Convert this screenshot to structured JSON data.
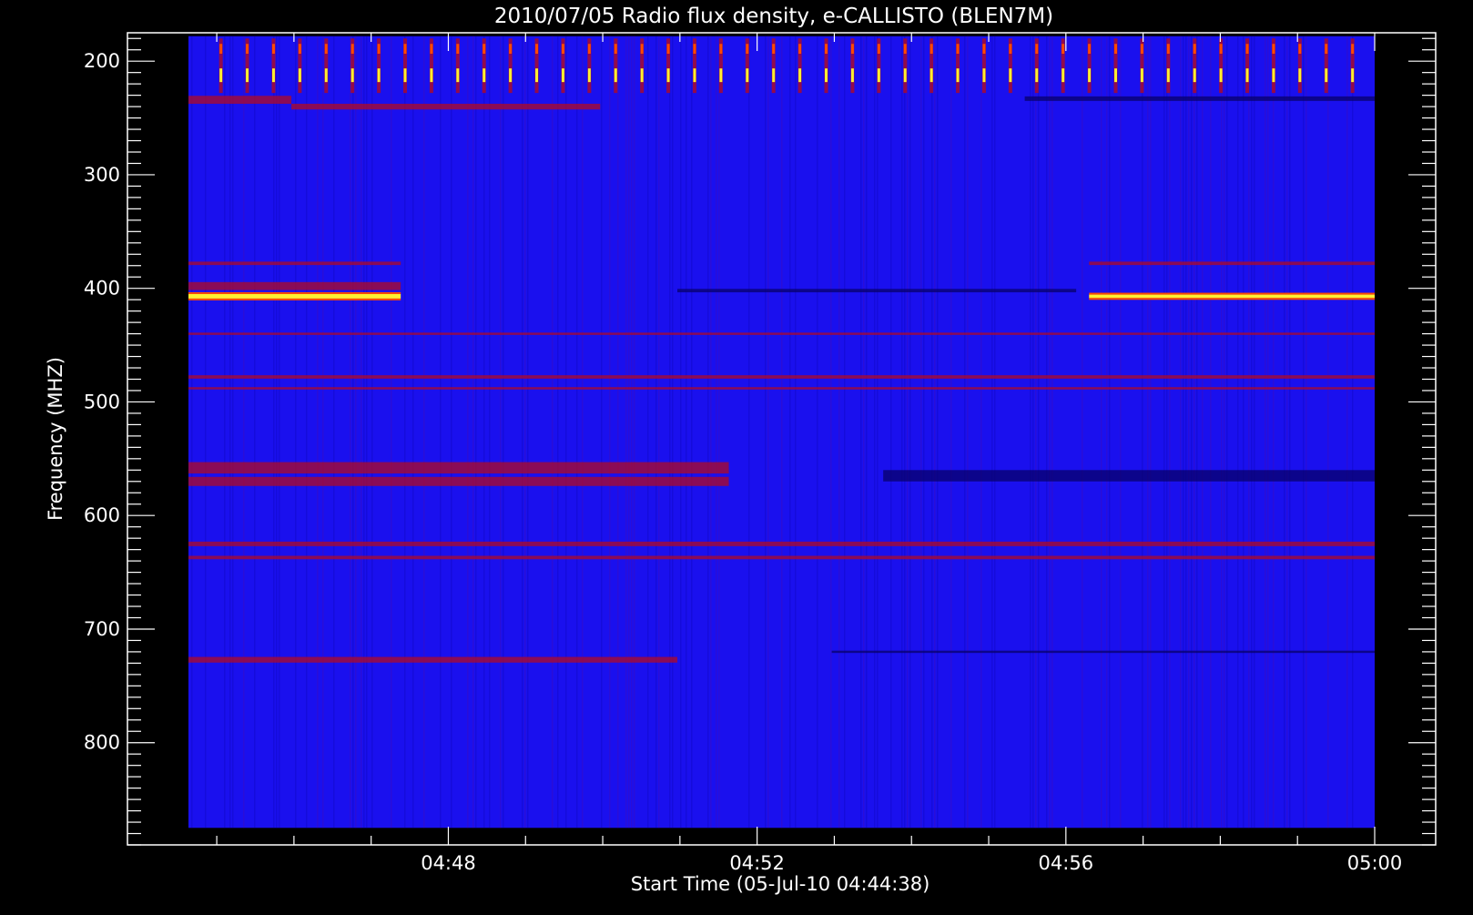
{
  "chart_data": {
    "type": "heatmap",
    "title": "2010/07/05  Radio flux density, e-CALLISTO (BLEN7M)",
    "xlabel": "Start Time (05-Jul-10 04:44:38)",
    "ylabel": "Frequency (MHZ)",
    "x_range_seconds_after_start": [
      0,
      922
    ],
    "ylim": [
      175,
      890
    ],
    "y_inverted": true,
    "xticks": [
      {
        "label": "04:48",
        "seconds_after_start": 202
      },
      {
        "label": "04:52",
        "seconds_after_start": 442
      },
      {
        "label": "04:56",
        "seconds_after_start": 682
      },
      {
        "label": "05:00",
        "seconds_after_start": 922
      }
    ],
    "yticks": [
      200,
      300,
      400,
      500,
      600,
      700,
      800
    ],
    "data_time_start_seconds": 0,
    "data_time_end_seconds": 922,
    "data_freq_range": [
      178,
      875
    ],
    "colormap": {
      "background": "#1a10ee",
      "low": "#08006a",
      "mid": "#b00a24",
      "high": "#ff4a00",
      "peak": "#fff030"
    },
    "features": [
      {
        "kind": "band",
        "freq": 407,
        "t_start": 0,
        "t_end": 165,
        "intensity": "peak",
        "width": 4
      },
      {
        "kind": "band",
        "freq": 407,
        "t_start": 700,
        "t_end": 922,
        "intensity": "peak",
        "width": 3
      },
      {
        "kind": "band",
        "freq": 398,
        "t_start": 0,
        "t_end": 165,
        "intensity": "mid",
        "width": 7
      },
      {
        "kind": "band",
        "freq": 378,
        "t_start": 0,
        "t_end": 165,
        "intensity": "mid",
        "width": 3
      },
      {
        "kind": "band",
        "freq": 378,
        "t_start": 700,
        "t_end": 922,
        "intensity": "mid",
        "width": 3
      },
      {
        "kind": "band",
        "freq": 234,
        "t_start": 0,
        "t_end": 80,
        "intensity": "mid",
        "width": 7
      },
      {
        "kind": "band",
        "freq": 240,
        "t_start": 80,
        "t_end": 320,
        "intensity": "mid",
        "width": 5
      },
      {
        "kind": "band",
        "freq": 233,
        "t_start": 650,
        "t_end": 922,
        "intensity": "low",
        "width": 4
      },
      {
        "kind": "band",
        "freq": 478,
        "t_start": 0,
        "t_end": 922,
        "intensity": "mid",
        "width": 3
      },
      {
        "kind": "band",
        "freq": 488,
        "t_start": 0,
        "t_end": 922,
        "intensity": "mid",
        "width": 2
      },
      {
        "kind": "band",
        "freq": 558,
        "t_start": 0,
        "t_end": 420,
        "intensity": "mid",
        "width": 10
      },
      {
        "kind": "band",
        "freq": 570,
        "t_start": 0,
        "t_end": 420,
        "intensity": "mid",
        "width": 8
      },
      {
        "kind": "band",
        "freq": 565,
        "t_start": 540,
        "t_end": 922,
        "intensity": "low",
        "width": 10
      },
      {
        "kind": "band",
        "freq": 625,
        "t_start": 0,
        "t_end": 922,
        "intensity": "mid",
        "width": 4
      },
      {
        "kind": "band",
        "freq": 637,
        "t_start": 0,
        "t_end": 922,
        "intensity": "mid",
        "width": 3
      },
      {
        "kind": "band",
        "freq": 727,
        "t_start": 0,
        "t_end": 380,
        "intensity": "mid",
        "width": 5
      },
      {
        "kind": "band",
        "freq": 720,
        "t_start": 500,
        "t_end": 922,
        "intensity": "low",
        "width": 2
      },
      {
        "kind": "band",
        "freq": 440,
        "t_start": 0,
        "t_end": 922,
        "intensity": "mid",
        "width": 2
      },
      {
        "kind": "band",
        "freq": 402,
        "t_start": 380,
        "t_end": 690,
        "intensity": "low",
        "width": 3
      },
      {
        "kind": "spike_comb",
        "freq_range": [
          180,
          228
        ],
        "t_start": 15,
        "t_end": 915,
        "count": 44,
        "intensity": "high"
      }
    ]
  }
}
